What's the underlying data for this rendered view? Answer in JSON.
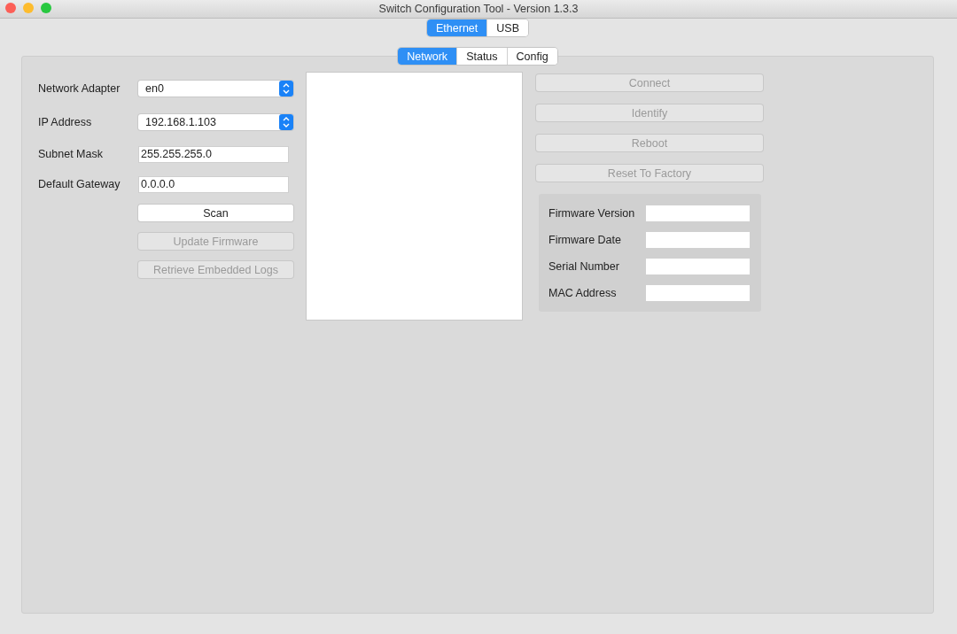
{
  "window": {
    "title": "Switch Configuration Tool - Version 1.3.3"
  },
  "connection_tabs": [
    {
      "label": "Ethernet",
      "selected": true
    },
    {
      "label": "USB",
      "selected": false
    }
  ],
  "view_tabs": [
    {
      "label": "Network",
      "selected": true
    },
    {
      "label": "Status",
      "selected": false
    },
    {
      "label": "Config",
      "selected": false
    }
  ],
  "network_fields": [
    {
      "label": "Network Adapter",
      "kind": "select",
      "value": "en0"
    },
    {
      "label": "IP Address",
      "kind": "select",
      "value": "192.168.1.103"
    },
    {
      "label": "Subnet Mask",
      "kind": "text",
      "value": "255.255.255.0"
    },
    {
      "label": "Default Gateway",
      "kind": "text",
      "value": "0.0.0.0"
    }
  ],
  "left_buttons": [
    {
      "label": "Scan",
      "disabled": false
    },
    {
      "label": "Update Firmware",
      "disabled": true
    },
    {
      "label": "Retrieve Embedded Logs",
      "disabled": true
    }
  ],
  "right_buttons": [
    {
      "label": "Connect",
      "disabled": true
    },
    {
      "label": "Identify",
      "disabled": true
    },
    {
      "label": "Reboot",
      "disabled": true
    },
    {
      "label": "Reset To Factory",
      "disabled": true
    }
  ],
  "device_info": [
    {
      "label": "Firmware Version"
    },
    {
      "label": "Firmware Date"
    },
    {
      "label": "Serial Number"
    },
    {
      "label": "MAC Address"
    }
  ]
}
